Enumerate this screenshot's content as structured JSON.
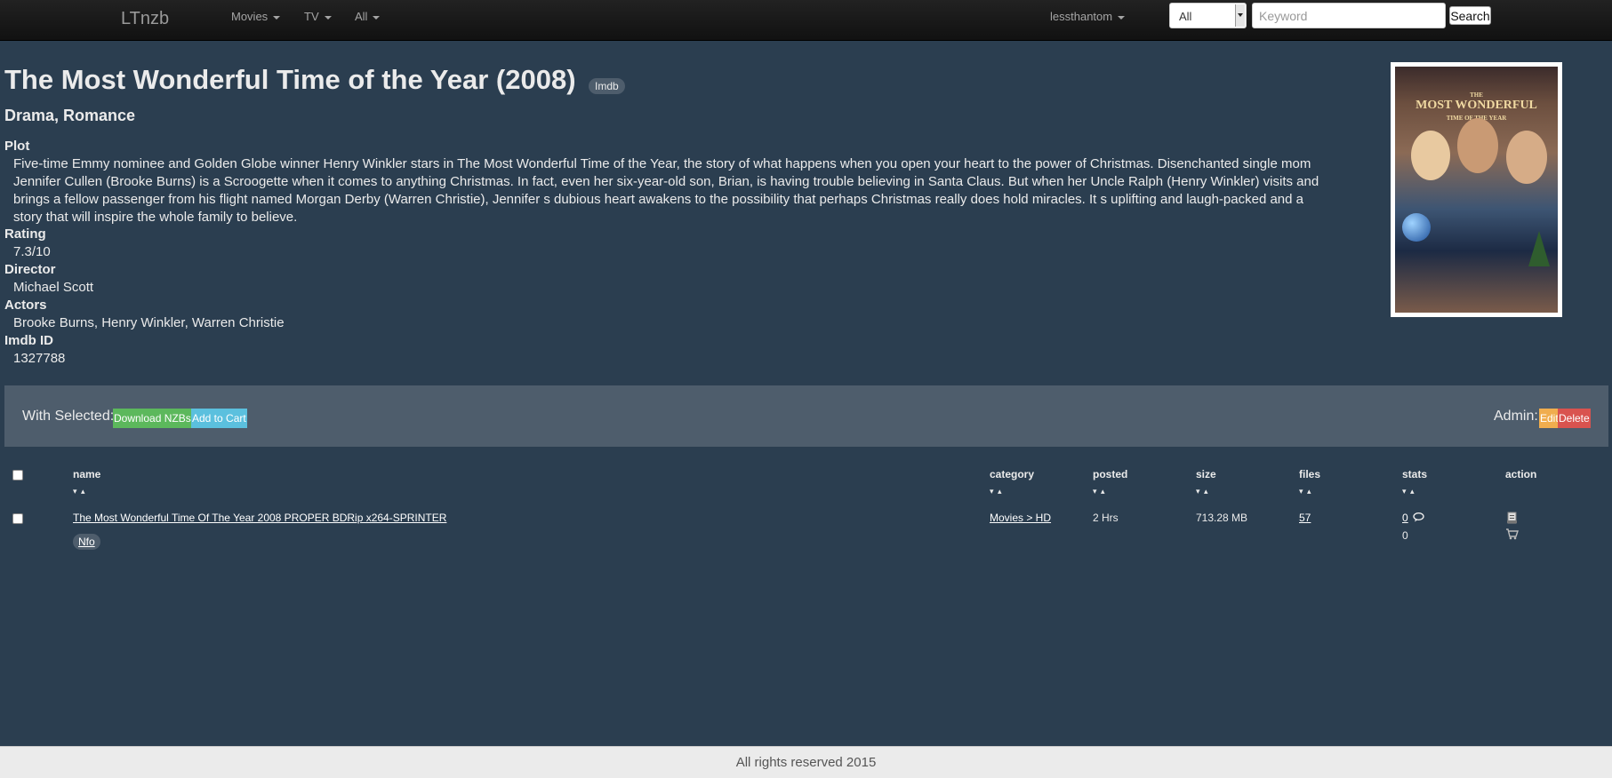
{
  "navbar": {
    "brand": "LTnzb",
    "menus": [
      {
        "label": "Movies"
      },
      {
        "label": "TV"
      },
      {
        "label": "All"
      }
    ],
    "user": "lessthantom",
    "search_category": "All",
    "search_placeholder": "Keyword",
    "search_button": "Search"
  },
  "movie": {
    "title": "The Most Wonderful Time of the Year (2008)",
    "imdb_badge": "Imdb",
    "genres": "Drama, Romance",
    "plot_label": "Plot",
    "plot": "Five-time Emmy nominee and Golden Globe winner Henry Winkler stars in The Most Wonderful Time of the Year, the story of what happens when you open your heart to the power of Christmas. Disenchanted single mom Jennifer Cullen (Brooke Burns) is a Scroogette when it comes to anything Christmas. In fact, even her six-year-old son, Brian, is having trouble believing in Santa Claus. But when her Uncle Ralph (Henry Winkler) visits and brings a fellow passenger from his flight named Morgan Derby (Warren Christie), Jennifer s dubious heart awakens to the possibility that perhaps Christmas really does hold miracles. It s uplifting and laugh-packed and a story that will inspire the whole family to believe.",
    "rating_label": "Rating",
    "rating": "7.3/10",
    "director_label": "Director",
    "director": "Michael Scott",
    "actors_label": "Actors",
    "actors": "Brooke Burns, Henry Winkler, Warren Christie",
    "imdb_id_label": "Imdb ID",
    "imdb_id": "1327788",
    "poster_title_line1": "THE",
    "poster_title_line2": "MOST WONDERFUL",
    "poster_title_line3": "TIME OF THE YEAR"
  },
  "actions": {
    "with_selected": "With Selected:",
    "download": "Download NZBs",
    "add_to_cart": "Add to Cart",
    "admin_label": "Admin:",
    "edit": "Edit",
    "delete": "Delete"
  },
  "table": {
    "headers": {
      "name": "name",
      "category": "category",
      "posted": "posted",
      "size": "size",
      "files": "files",
      "stats": "stats",
      "action": "action"
    },
    "sort_glyphs": "▾ ▴",
    "rows": [
      {
        "name": "The Most Wonderful Time Of The Year 2008 PROPER BDRip x264-SPRINTER",
        "nfo": "Nfo",
        "category": "Movies > HD",
        "posted": "2 Hrs",
        "size": "713.28 MB",
        "files": "57",
        "comments": "0",
        "grabs": "0"
      }
    ]
  },
  "footer": {
    "text": "All rights reserved 2015"
  }
}
